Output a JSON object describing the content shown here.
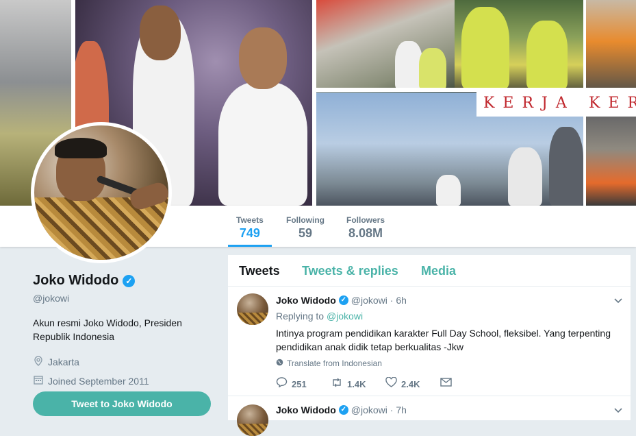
{
  "banner": {
    "slogan_left": "KERJA",
    "slogan_right": "KER"
  },
  "nav": {
    "stats": [
      {
        "label": "Tweets",
        "value": "749"
      },
      {
        "label": "Following",
        "value": "59"
      },
      {
        "label": "Followers",
        "value": "8.08M"
      }
    ]
  },
  "profile": {
    "name": "Joko Widodo",
    "handle": "@jokowi",
    "bio": "Akun resmi Joko Widodo, Presiden Republik Indonesia",
    "location": "Jakarta",
    "joined": "Joined September 2011",
    "tweet_to_label": "Tweet to Joko Widodo"
  },
  "timeline": {
    "tabs": [
      "Tweets",
      "Tweets & replies",
      "Media"
    ],
    "tweets": [
      {
        "name": "Joko Widodo",
        "handle": "@jokowi · 6h",
        "replying_label": "Replying to",
        "replying_to": "@jokowi",
        "text": "Intinya program pendidikan karakter Full Day School, fleksibel. Yang terpenting pendidikan anak didik tetap berkualitas -Jkw",
        "translate": "Translate from Indonesian",
        "replies": "251",
        "retweets": "1.4K",
        "likes": "2.4K"
      },
      {
        "name": "Joko Widodo",
        "handle": "@jokowi · 7h"
      }
    ]
  },
  "colors": {
    "accent": "#1da1f2",
    "teal": "#4ab3a8",
    "background": "#e6ecf0"
  }
}
